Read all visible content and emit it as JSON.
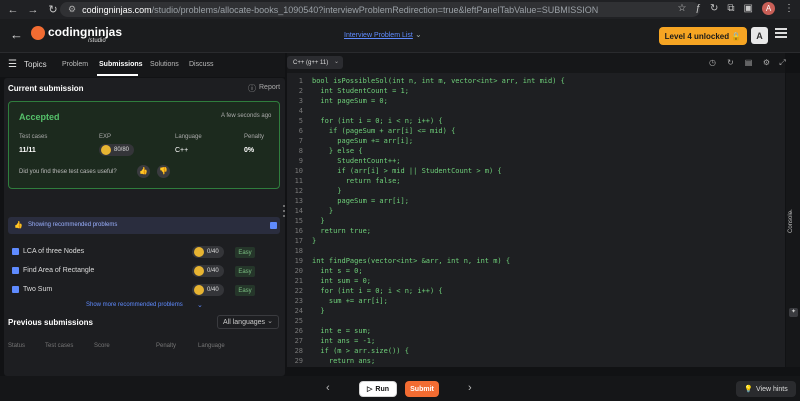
{
  "browser": {
    "url_host": "codingninjas.com",
    "url_rest": "/studio/problems/allocate-books_1090540?interviewProblemRedirection=true&leftPanelTabValue=SUBMISSION",
    "profile_initial": "A"
  },
  "header": {
    "logo_text": "codingninjas",
    "logo_sub": "/studio",
    "problem_list_link": "Interview Problem List",
    "level_badge": "Level 4 unlocked 🔒",
    "user_initial": "A"
  },
  "tabs": {
    "topics": "Topics",
    "items": [
      "Problem",
      "Submissions",
      "Solutions",
      "Discuss"
    ],
    "active": "Submissions"
  },
  "submission": {
    "heading": "Current submission",
    "report": "Report",
    "status": "Accepted",
    "time": "A few seconds ago",
    "cols": [
      {
        "label": "Test cases",
        "value": "11/11"
      },
      {
        "label": "EXP",
        "value": "80/80"
      },
      {
        "label": "Language",
        "value": "C++"
      },
      {
        "label": "Penalty",
        "value": "0%"
      }
    ],
    "feedback_question": "Did you find these test cases useful?"
  },
  "recommended": {
    "banner": "Showing recommended problems",
    "items": [
      {
        "name": "LCA of three Nodes",
        "exp": "0/40",
        "difficulty": "Easy"
      },
      {
        "name": "Find Area of Rectangle",
        "exp": "0/40",
        "difficulty": "Easy"
      },
      {
        "name": "Two Sum",
        "exp": "0/40",
        "difficulty": "Easy"
      }
    ],
    "show_more": "Show more recommended problems"
  },
  "previous": {
    "heading": "Previous submissions",
    "filter": "All languages",
    "columns": [
      "Status",
      "Test cases",
      "Score",
      "Penalty",
      "Language"
    ]
  },
  "editor": {
    "language": "C++ (g++ 11)",
    "lines": [
      "bool isPossibleSol(int n, int m, vector<int> arr, int mid) {",
      "  int StudentCount = 1;",
      "  int pageSum = 0;",
      "",
      "  for (int i = 0; i < n; i++) {",
      "    if (pageSum + arr[i] <= mid) {",
      "      pageSum += arr[i];",
      "    } else {",
      "      StudentCount++;",
      "      if (arr[i] > mid || StudentCount > m) {",
      "        return false;",
      "      }",
      "      pageSum = arr[i];",
      "    }",
      "  }",
      "  return true;",
      "}",
      "",
      "int findPages(vector<int> &arr, int n, int m) {",
      "  int s = 0;",
      "  int sum = 0;",
      "  for (int i = 0; i < n; i++) {",
      "    sum += arr[i];",
      "  }",
      "",
      "  int e = sum;",
      "  int ans = -1;",
      "  if (m > arr.size()) {",
      "    return ans;"
    ],
    "console_label": "Console"
  },
  "bottom": {
    "run": "Run",
    "submit": "Submit",
    "hints": "View hints"
  },
  "colors": {
    "accent_orange": "#f26c32",
    "success_green": "#2f7d3d",
    "code_green": "#6fd07a",
    "link_blue": "#5f8bff"
  }
}
